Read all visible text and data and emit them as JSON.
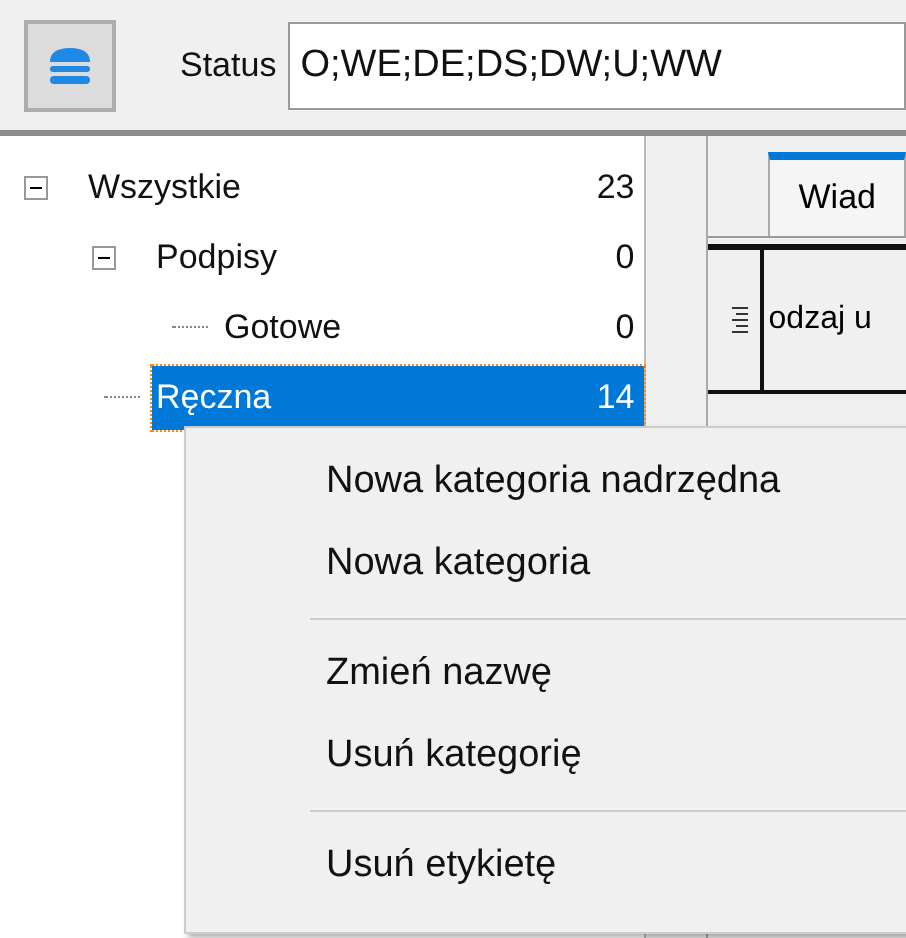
{
  "toolbar": {
    "status_label": "Status",
    "status_value": "O;WE;DE;DS;DW;U;WW"
  },
  "tree": [
    {
      "label": "Wszystkie",
      "count": "23",
      "expanded": true,
      "selected": false,
      "children": [
        {
          "label": "Podpisy",
          "count": "0",
          "expanded": true,
          "selected": false,
          "children": [
            {
              "label": "Gotowe",
              "count": "0",
              "selected": false
            }
          ]
        },
        {
          "label": "Ręczna",
          "count": "14",
          "selected": true
        }
      ]
    }
  ],
  "tabs": [
    {
      "label": "Wiad",
      "selected": true
    }
  ],
  "grid": {
    "columns": [
      "odzaj u"
    ]
  },
  "context_menu": {
    "groups": [
      {
        "items": [
          "Nowa kategoria nadrzędna",
          "Nowa kategoria"
        ]
      },
      {
        "items": [
          "Zmień nazwę",
          "Usuń kategorię"
        ]
      },
      {
        "items": [
          "Usuń etykietę"
        ]
      }
    ]
  }
}
